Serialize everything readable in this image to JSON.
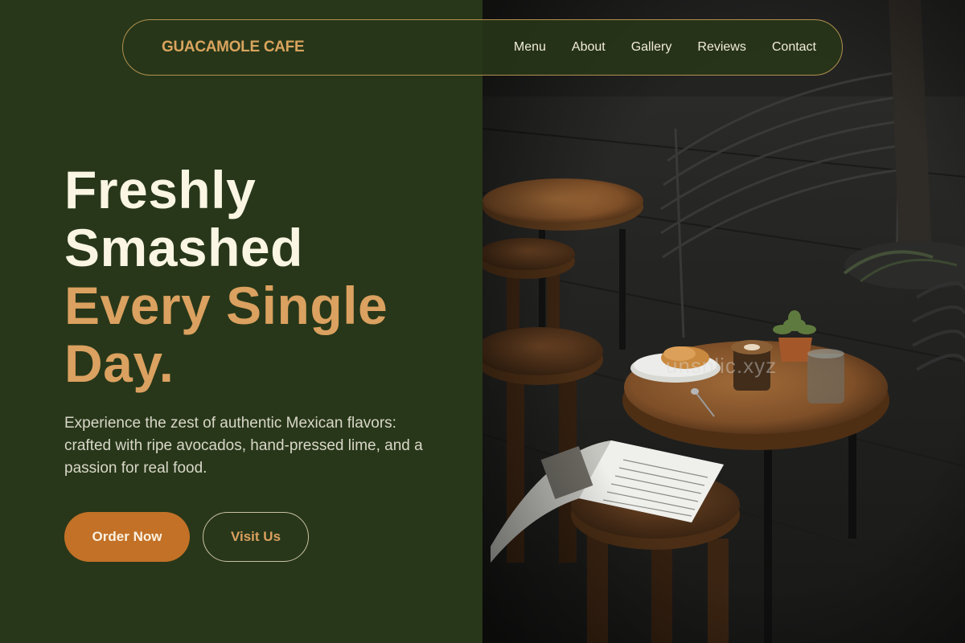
{
  "nav": {
    "brand": "GUACAMOLE CAFE",
    "links": [
      "Menu",
      "About",
      "Gallery",
      "Reviews",
      "Contact"
    ]
  },
  "hero": {
    "title_line1": "Freshly",
    "title_line2": "Smashed",
    "title_line3": "Every Single",
    "title_line4": "Day.",
    "description": "Experience the zest of authentic Mexican flavors: crafted with ripe avocados, hand-pressed lime, and a passion for real food.",
    "primary_button": "Order Now",
    "secondary_button": "Visit Us"
  },
  "photo": {
    "watermark": "unsplic.xyz"
  },
  "colors": {
    "background": "#283719",
    "accent": "#c27127",
    "brand": "#d9a45e",
    "heading_cream": "#faf6e3",
    "heading_gold": "#dba160"
  }
}
